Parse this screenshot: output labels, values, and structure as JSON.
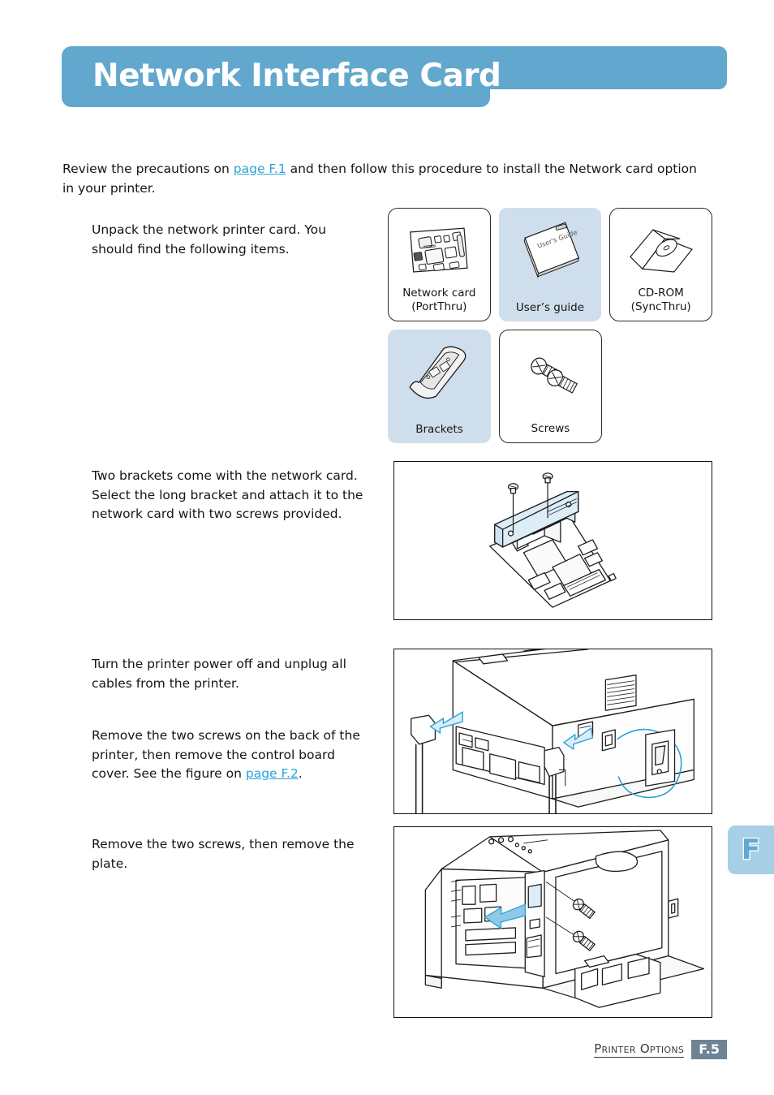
{
  "page": {
    "title": "Network Interface Card",
    "intro": {
      "before_link": "Review the precautions on ",
      "link": "page F.1",
      "after_link": " and then follow this procedure to install the Network card option in your printer."
    },
    "steps": [
      {
        "id": "step-1",
        "text": "Unpack the network printer card. You should find the following items."
      },
      {
        "id": "step-2",
        "text": "Two brackets come with the network card. Select the long bracket and attach it to the network card with two screws provided."
      },
      {
        "id": "step-3",
        "text": "Turn the printer power off and unplug all cables from the printer."
      },
      {
        "id": "step-4",
        "before_link": "Remove the two screws on the back of the printer, then remove the control board cover. See the figure on ",
        "link": "page F.2",
        "after_link": "."
      },
      {
        "id": "step-5",
        "text": "Remove the two screws, then remove the plate."
      }
    ],
    "items": [
      {
        "label_line1": "Network card",
        "label_line2": "(PortThru)",
        "art": "network-card-art",
        "shaded": false
      },
      {
        "label_line1": "User’s guide",
        "label_line2": "",
        "art": "users-guide-art",
        "shaded": true
      },
      {
        "label_line1": "CD-ROM",
        "label_line2": "(SyncThru)",
        "art": "cd-rom-art",
        "shaded": false
      },
      {
        "label_line1": "Brackets",
        "label_line2": "",
        "art": "brackets-art",
        "shaded": true
      },
      {
        "label_line1": "Screws",
        "label_line2": "",
        "art": "screws-art",
        "shaded": false
      }
    ],
    "guide_cover_text": "User's Guide",
    "figures": [
      {
        "id": "figure-network-card-bracket",
        "caption": "Network card with long bracket attached by two screws"
      },
      {
        "id": "figure-printer-rear-cables",
        "caption": "Printer rear with cables unplugged and power switch callout"
      },
      {
        "id": "figure-printer-plate-screws",
        "caption": "Printer control board with two plate screws removed"
      }
    ],
    "chapter_tab": "F",
    "footer": {
      "chapter_name": "Printer Options",
      "page_number": "F.5"
    },
    "colors": {
      "banner_blue": "#62A8CE",
      "link_blue": "#29A3D8",
      "shaded_box": "#CFDEEC",
      "tab_blue": "#A7D0E6",
      "footer_badge": "#6E8494",
      "figure_accent": "#29A3D8",
      "bracket_fill": "#DCEDF7"
    }
  }
}
